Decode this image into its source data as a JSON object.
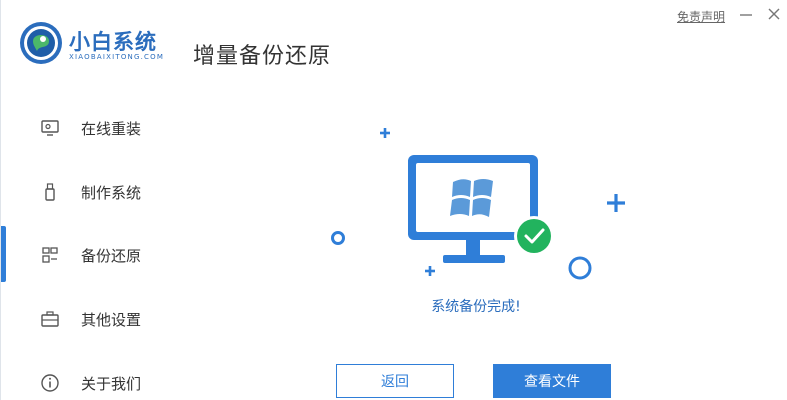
{
  "brand": {
    "name": "小白系统",
    "subtitle": "XIAOBAIXITONG.COM"
  },
  "header": {
    "title": "增量备份还原",
    "disclaimer": "免责声明"
  },
  "sidebar": {
    "items": [
      {
        "label": "在线重装",
        "icon": "monitor-icon"
      },
      {
        "label": "制作系统",
        "icon": "usb-drive-icon"
      },
      {
        "label": "备份还原",
        "icon": "backup-grid-icon",
        "active": true
      },
      {
        "label": "其他设置",
        "icon": "briefcase-icon"
      },
      {
        "label": "关于我们",
        "icon": "info-icon"
      }
    ]
  },
  "main": {
    "status": "系统备份完成!",
    "buttons": {
      "back": "返回",
      "view_file": "查看文件"
    }
  },
  "colors": {
    "accent": "#2f7ed8",
    "brand": "#2b6dbd",
    "success": "#22b35e"
  }
}
